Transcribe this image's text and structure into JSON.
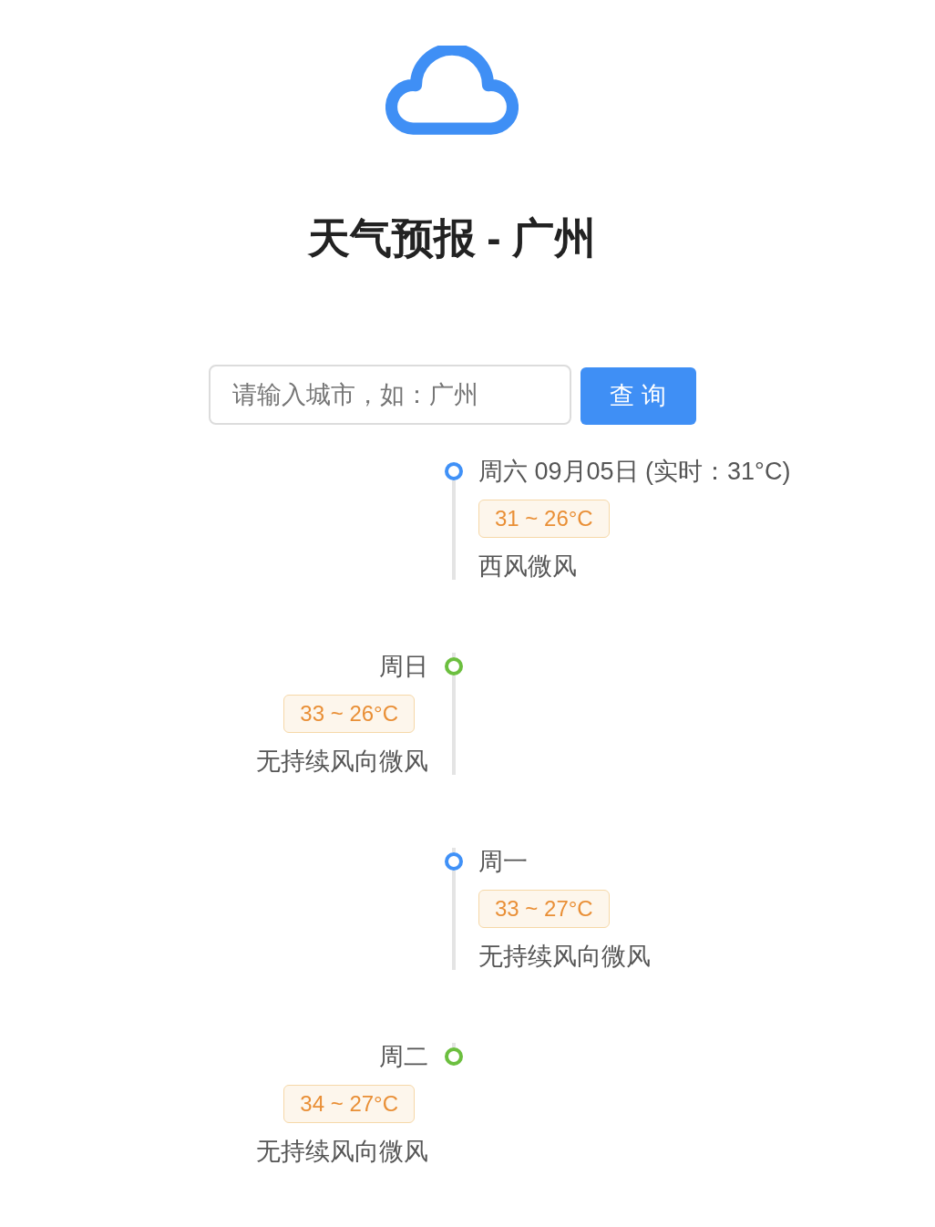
{
  "header": {
    "title": "天气预报 - 广州"
  },
  "search": {
    "placeholder": "请输入城市，如：广州",
    "button": "查 询"
  },
  "days": [
    {
      "title": "周六 09月05日 (实时：31°C)",
      "temperature": "31 ~ 26°C",
      "wind": "西风微风",
      "color": "#4091f7"
    },
    {
      "title": "周日",
      "temperature": "33 ~ 26°C",
      "wind": "无持续风向微风",
      "color": "#6cbf3f"
    },
    {
      "title": "周一",
      "temperature": "33 ~ 27°C",
      "wind": "无持续风向微风",
      "color": "#4091f7"
    },
    {
      "title": "周二",
      "temperature": "34 ~ 27°C",
      "wind": "无持续风向微风",
      "color": "#6cbf3f"
    }
  ]
}
